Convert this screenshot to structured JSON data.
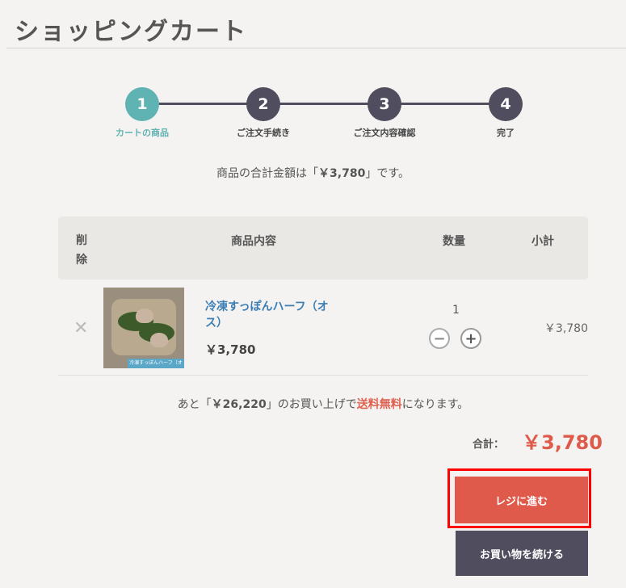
{
  "header": {
    "title": "ショッピングカート"
  },
  "steps": [
    {
      "num": "1",
      "label": "カートの商品",
      "active": true
    },
    {
      "num": "2",
      "label": "ご注文手続き",
      "active": false
    },
    {
      "num": "3",
      "label": "ご注文内容確認",
      "active": false
    },
    {
      "num": "4",
      "label": "完了",
      "active": false
    }
  ],
  "summary": {
    "prefix": "商品の合計金額は「",
    "amount": "￥3,780",
    "suffix": "」です。"
  },
  "table": {
    "headers": {
      "delete": "削除",
      "item": "商品内容",
      "quantity": "数量",
      "subtotal": "小計"
    },
    "rows": [
      {
        "name": "冷凍すっぽんハーフ（オス）",
        "price": "￥3,780",
        "quantity": "1",
        "subtotal": "￥3,780",
        "thumb_caption": "冷凍すっぽんハーフ（オス）"
      }
    ]
  },
  "shipping": {
    "prefix": "あと「",
    "amount": "￥26,220",
    "middle": "」のお買い上げで",
    "free": "送料無料",
    "suffix": "になります。"
  },
  "grand_total": {
    "label": "合計：",
    "value": "￥3,780"
  },
  "buttons": {
    "checkout": "レジに進む",
    "continue": "お買い物を続ける"
  },
  "icons": {
    "remove": "close-icon",
    "minus": "minus-icon",
    "plus": "plus-icon"
  },
  "colors": {
    "accent_teal": "#5fb3b3",
    "step_dark": "#4f4d5e",
    "price_red": "#de5a4a",
    "checkout_red": "#e05a4b",
    "link_blue": "#3c7eb4",
    "highlight_outline": "#ff0000"
  }
}
